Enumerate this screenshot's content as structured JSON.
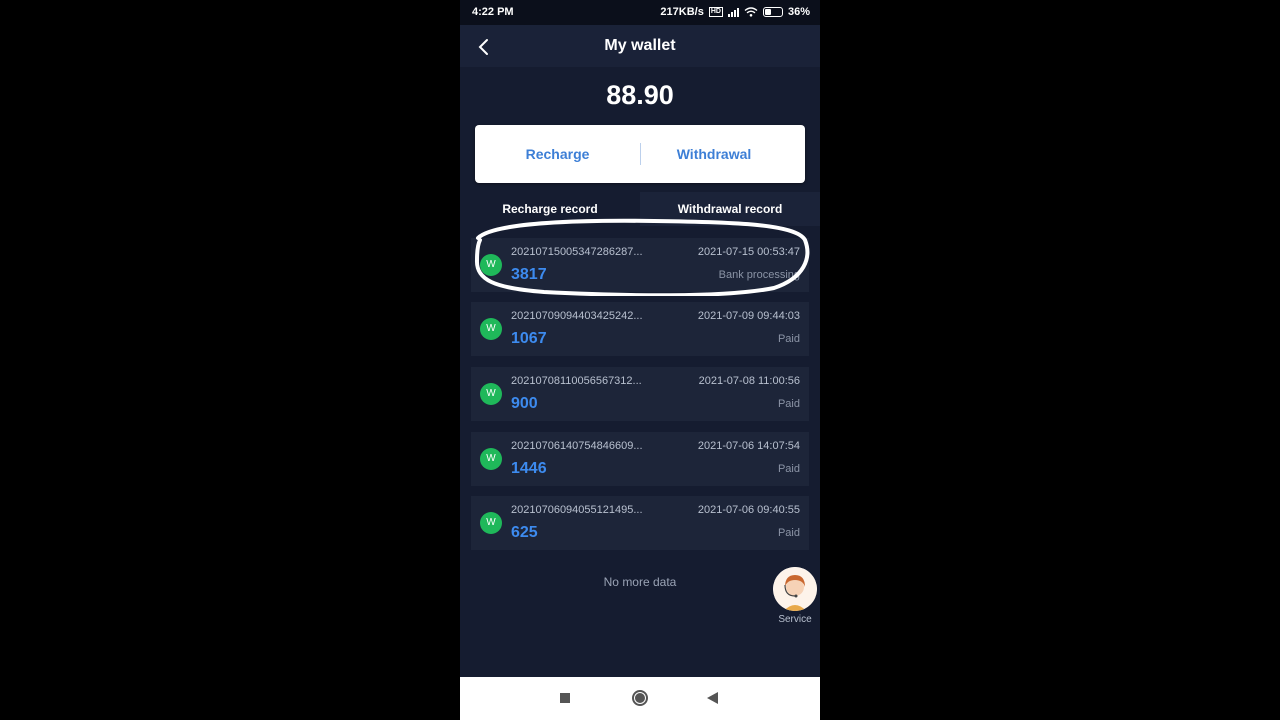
{
  "status_bar": {
    "time": "4:22 PM",
    "net_speed": "217KB/s",
    "net_badge": "HD",
    "battery": "36%"
  },
  "header": {
    "title": "My wallet",
    "back_icon": "chevron-left-icon"
  },
  "wallet": {
    "balance": "88.90",
    "recharge_label": "Recharge",
    "withdrawal_label": "Withdrawal"
  },
  "tabs": [
    {
      "label": "Recharge record"
    },
    {
      "label": "Withdrawal record"
    }
  ],
  "records": [
    {
      "badge": "W",
      "order": "20210715005347286287...",
      "amount": "3817",
      "date": "2021-07-15 00:53:47",
      "status": "Bank processing"
    },
    {
      "badge": "W",
      "order": "20210709094403425242...",
      "amount": "1067",
      "date": "2021-07-09 09:44:03",
      "status": "Paid"
    },
    {
      "badge": "W",
      "order": "20210708110056567312...",
      "amount": "900",
      "date": "2021-07-08 11:00:56",
      "status": "Paid"
    },
    {
      "badge": "W",
      "order": "20210706140754846609...",
      "amount": "1446",
      "date": "2021-07-06 14:07:54",
      "status": "Paid"
    },
    {
      "badge": "W",
      "order": "20210706094055121495...",
      "amount": "625",
      "date": "2021-07-06 09:40:55",
      "status": "Paid"
    }
  ],
  "footer_text": "No more data",
  "service": {
    "label": "Service"
  },
  "colors": {
    "accent_blue": "#3d8bef",
    "badge_green": "#1fb85a",
    "background": "#151c30",
    "card": "#1d2539"
  }
}
